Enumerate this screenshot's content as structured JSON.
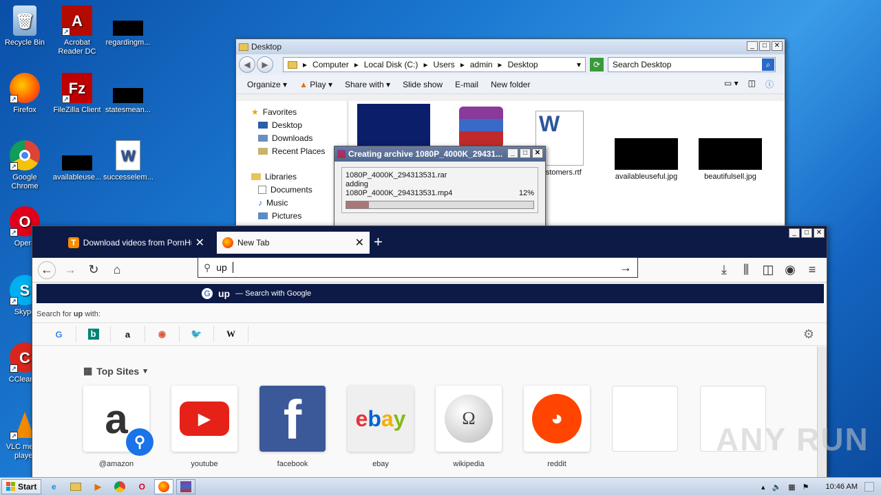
{
  "desktop": {
    "icons": [
      {
        "label": "Recycle Bin",
        "icon": "recycle-bin-icon"
      },
      {
        "label": "Acrobat Reader DC",
        "icon": "acrobat-icon"
      },
      {
        "label": "regardingm...",
        "icon": "file-icon"
      },
      {
        "label": "Firefox",
        "icon": "firefox-icon"
      },
      {
        "label": "FileZilla Client",
        "icon": "filezilla-icon"
      },
      {
        "label": "statesmean...",
        "icon": "file-icon"
      },
      {
        "label": "Google Chrome",
        "icon": "chrome-icon"
      },
      {
        "label": "availableuse...",
        "icon": "file-icon"
      },
      {
        "label": "successelem...",
        "icon": "word-icon"
      },
      {
        "label": "Opera",
        "icon": "opera-icon"
      },
      {
        "label": "Skype",
        "icon": "skype-icon"
      },
      {
        "label": "CCleaner",
        "icon": "ccleaner-icon"
      },
      {
        "label": "VLC media player",
        "icon": "vlc-icon"
      }
    ]
  },
  "explorer": {
    "title": "Desktop",
    "breadcrumb": [
      "Computer",
      "Local Disk (C:)",
      "Users",
      "admin",
      "Desktop"
    ],
    "search_placeholder": "Search Desktop",
    "commands": [
      "Organize",
      "Play",
      "Share with",
      "Slide show",
      "E-mail",
      "New folder"
    ],
    "nav": {
      "favorites": "Favorites",
      "favorites_items": [
        "Desktop",
        "Downloads",
        "Recent Places"
      ],
      "libraries": "Libraries",
      "libraries_items": [
        "Documents",
        "Music",
        "Pictures"
      ]
    },
    "files": [
      "customers.rtf",
      "availableuseful.jpg",
      "beautifulsell.jpg"
    ]
  },
  "rar": {
    "title": "Creating archive 1080P_4000K_29431...",
    "archive": "1080P_4000K_294313531.rar",
    "action": "adding",
    "file": "1080P_4000K_294313531.mp4",
    "percent_label": "12%",
    "percent": 0.12
  },
  "firefox": {
    "tabs": [
      {
        "label": "Download videos from PornHub to",
        "active": false
      },
      {
        "label": "New Tab",
        "active": true
      }
    ],
    "url_value": "up",
    "suggestion_term": "up",
    "suggestion_action": "— Search with Google",
    "search_for_prefix": "Search for",
    "search_for_term": "up",
    "search_for_suffix": "with:",
    "engines": [
      "G",
      "b",
      "a",
      "◉",
      "🐦",
      "W"
    ],
    "topsites_title": "Top Sites",
    "topsites": [
      "@amazon",
      "youtube",
      "facebook",
      "ebay",
      "wikipedia",
      "reddit",
      "",
      ""
    ]
  },
  "taskbar": {
    "start": "Start",
    "time": "10:46 AM"
  },
  "watermark": "ANY RUN",
  "colors": {
    "ff_dark": "#0c1a45",
    "facebook": "#3b5998",
    "youtube": "#e62117",
    "reddit": "#ff4500"
  }
}
